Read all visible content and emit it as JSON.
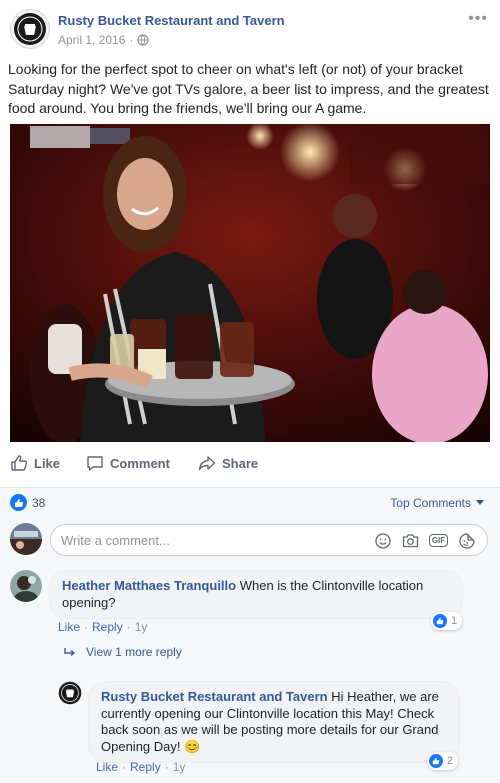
{
  "post": {
    "page_name": "Rusty Bucket Restaurant and Tavern",
    "date": "April 1, 2016",
    "date_separator": "·",
    "more_icon": "ellipsis-icon",
    "text": "Looking for the perfect spot to cheer on what's left (or not) of your bracket Saturday night? We've got TVs galore, a beer list to impress, and the greatest food around. You bring the friends, we'll bring our A game."
  },
  "actions": {
    "like": "Like",
    "comment": "Comment",
    "share": "Share"
  },
  "reactions": {
    "count": "38",
    "sort_label": "Top Comments"
  },
  "composer": {
    "placeholder": "Write a comment...",
    "gif_label": "GIF"
  },
  "comments": [
    {
      "author": "Heather Matthaes Tranquillo",
      "text": "When is the Clintonville location opening?",
      "like": "Like",
      "reply": "Reply",
      "time": "1y",
      "reactions": "1"
    }
  ],
  "view_more": "View 1 more reply",
  "reply": {
    "author": "Rusty Bucket Restaurant and Tavern",
    "text": "Hi Heather, we are currently opening our Clintonville location this May! Check back soon as we will be posting more details for our Grand Opening Day! 😊",
    "like": "Like",
    "reply": "Reply",
    "time": "1y",
    "reactions": "2"
  },
  "colors": {
    "link_blue": "#365899",
    "like_blue": "#1877f2",
    "muted_gray": "#90949c"
  }
}
